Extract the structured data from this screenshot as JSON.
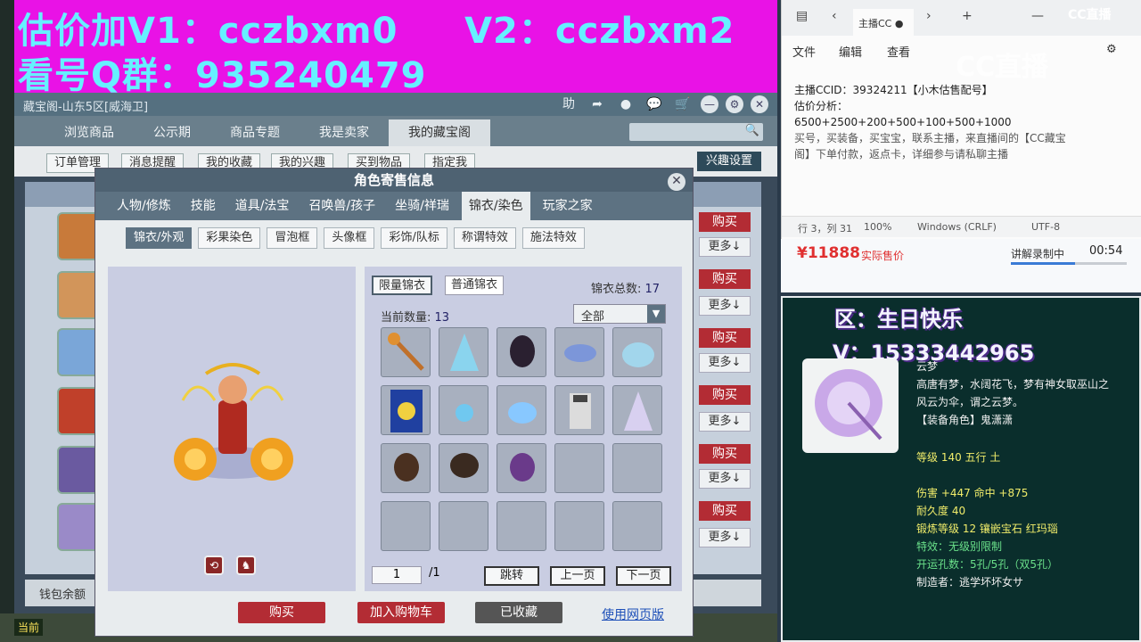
{
  "banner": {
    "line1": "估价加V1：cczbxm0     V2：cczbxm2",
    "line2": "看号Q群：935240479"
  },
  "game": {
    "window_title": "藏宝阁-山东5区[威海卫]",
    "help_label": "助",
    "nav_tabs": [
      "浏览商品",
      "公示期",
      "商品专题",
      "我是卖家",
      "我的藏宝阁"
    ],
    "sub_buttons": [
      "订单管理",
      "消息提醒",
      "我的收藏",
      "我的兴趣",
      "买到物品",
      "指定我"
    ],
    "interest_settings": "兴趣设置",
    "buy_label": "购买",
    "more_label": "更多↓",
    "wallet_label": "钱包余额",
    "current_label": "当前"
  },
  "modal": {
    "title": "角色寄售信息",
    "tabs": [
      "人物/修炼",
      "技能",
      "道具/法宝",
      "召唤兽/孩子",
      "坐骑/祥瑞",
      "锦衣/染色",
      "玩家之家"
    ],
    "subtabs": [
      "锦衣/外观",
      "彩果染色",
      "冒泡框",
      "头像框",
      "彩饰/队标",
      "称谓特效",
      "施法特效"
    ],
    "type_tabs": [
      "限量锦衣",
      "普通锦衣"
    ],
    "total_label": "锦衣总数:",
    "total_value": "17",
    "current_count_label": "当前数量:",
    "current_count_value": "13",
    "filter_value": "全部",
    "page_input": "1",
    "page_total": "/1",
    "btn_jump": "跳转",
    "btn_prev": "上一页",
    "btn_next": "下一页",
    "footer_buy": "购买",
    "footer_add_cart": "加入购物车",
    "footer_favorited": "已收藏",
    "footer_web": "使用网页版"
  },
  "notepad": {
    "tab_title": "主播CC",
    "menu": [
      "文件",
      "编辑",
      "查看"
    ],
    "text_lines": [
      "主播CCID：39324211【小木估售配号】",
      "估价分析：",
      "6500+2500+200+500+100+500+1000",
      "买号，买装备，买宝宝，联系主播，来直播间的【CC藏宝",
      "阁】下单付款，返点卡，详细参与请私聊主播"
    ],
    "status": [
      "行 3，列 31",
      "100%",
      "Windows (CRLF)",
      "UTF-8"
    ],
    "cc_logo": "CC直播",
    "cc_watermark": "CC直播"
  },
  "price_bar": {
    "price": "¥11888",
    "price_label": "实际售价",
    "recording": "讲解录制中",
    "time": "00:54",
    "progress": 0.55
  },
  "item": {
    "zone": "区：生日快乐",
    "v_line": "V：15333442965",
    "name": "云梦",
    "desc1": "高唐有梦，水阔花飞，梦有神女取巫山之",
    "desc2": "风云为伞，谓之云梦。",
    "role": "【装备角色】鬼潇潇",
    "level": "等级 140 五行 土",
    "damage": "伤害 +447 命中 +875",
    "durability": "耐久度 40",
    "forge": "锻炼等级 12 镶嵌宝石 红玛瑙",
    "effect": "特效：无级别限制",
    "holes": "开运孔数：5孔/5孔（双5孔）",
    "maker": "制造者：逃学坏坏女サ"
  },
  "colors": {
    "banner_bg": "#e912e6",
    "banner_text": "#66f0ff",
    "buy_red": "#b32c34",
    "price_red": "#e03030",
    "item_bg": "#0a2e2c"
  }
}
